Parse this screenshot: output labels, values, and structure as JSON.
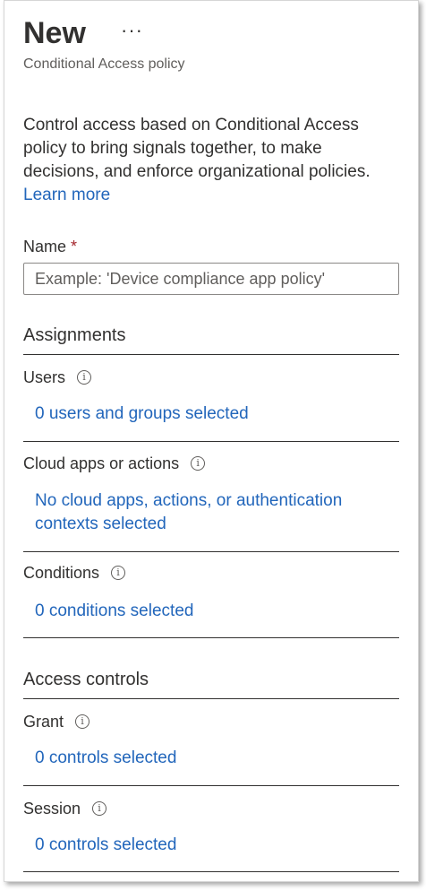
{
  "header": {
    "title": "New",
    "more_label": "···",
    "subtitle": "Conditional Access policy"
  },
  "description": {
    "text": "Control access based on Conditional Access policy to bring signals together, to make decisions, and enforce organizational policies.",
    "learn_more": "Learn more"
  },
  "name_field": {
    "label": "Name",
    "required_marker": "*",
    "placeholder": "Example: 'Device compliance app policy'",
    "value": ""
  },
  "assignments": {
    "heading": "Assignments",
    "users": {
      "label": "Users",
      "value": "0 users and groups selected"
    },
    "cloud_apps": {
      "label": "Cloud apps or actions",
      "value_line1": "No cloud apps, actions, or authentication",
      "value_line2": "contexts selected"
    },
    "conditions": {
      "label": "Conditions",
      "value": "0 conditions selected"
    }
  },
  "access_controls": {
    "heading": "Access controls",
    "grant": {
      "label": "Grant",
      "value": "0 controls selected"
    },
    "session": {
      "label": "Session",
      "value": "0 controls selected"
    }
  },
  "icons": {
    "info": "info-icon",
    "more": "ellipsis-icon"
  },
  "colors": {
    "link": "#2266bb",
    "required": "#a4262c",
    "text": "#323130",
    "muted": "#605e5c"
  }
}
